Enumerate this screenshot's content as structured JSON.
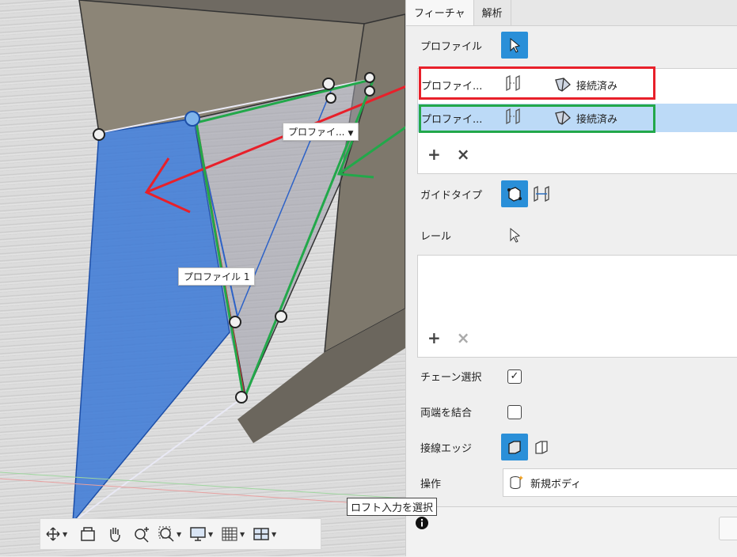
{
  "viewport": {
    "labels": {
      "profile_tag_top": "プロファイ...",
      "profile_tag_1": "プロファイル 1"
    },
    "colors": {
      "blue_face": "#3a78d6",
      "annotation_red": "#e8202a",
      "annotation_green": "#22a84a"
    }
  },
  "toolbar": {
    "icons": [
      "orbit-icon",
      "look-at-icon",
      "pan-hand-icon",
      "zoom-icon",
      "zoom-window-icon",
      "display-settings-icon",
      "grid-icon",
      "viewports-icon"
    ]
  },
  "tooltip": {
    "text": "ロフト入力を選択"
  },
  "panel": {
    "tabs": [
      {
        "label": "フィーチャ"
      },
      {
        "label": "解析"
      }
    ],
    "profile_label": "プロファイル",
    "profiles": [
      {
        "name": "プロファイ...",
        "status": "接続済み"
      },
      {
        "name": "プロファイ...",
        "status": "接続済み"
      }
    ],
    "guide_type_label": "ガイドタイプ",
    "rail_label": "レール",
    "chain_select_label": "チェーン選択",
    "chain_select_checked": true,
    "close_both_ends_label": "両端を結合",
    "close_both_ends_checked": false,
    "tangent_edges_label": "接線エッジ",
    "operation_label": "操作",
    "operation_value": "新規ボディ",
    "info_icon": "info-icon"
  }
}
